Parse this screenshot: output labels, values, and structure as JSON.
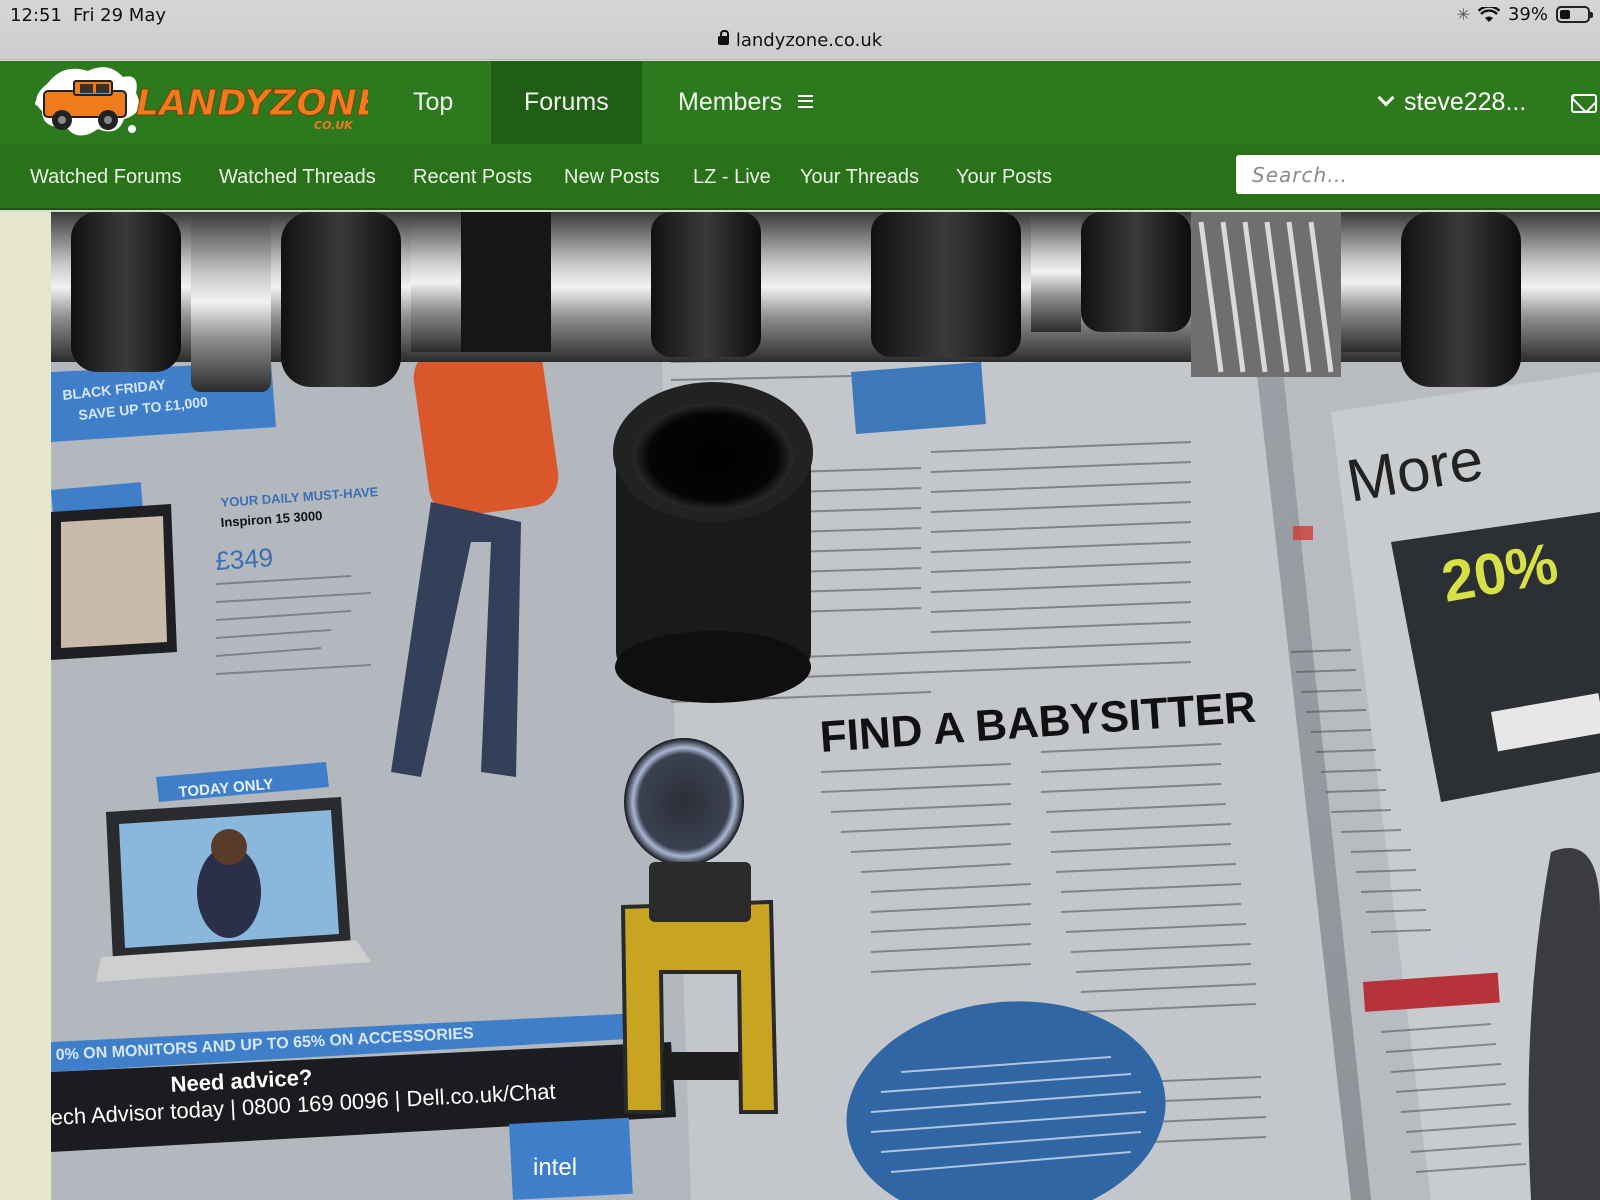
{
  "status": {
    "time": "12:51",
    "date": "Fri 29 May",
    "battery": "39%",
    "battery_level": 0.39
  },
  "browser": {
    "url": "landyzone.co.uk"
  },
  "logo": {
    "name": "LANDYZONE",
    "suffix": "CO.UK"
  },
  "nav": {
    "tabs": [
      {
        "label": "Top"
      },
      {
        "label": "Forums"
      },
      {
        "label": "Members"
      }
    ],
    "user": "steve228..."
  },
  "subnav": {
    "items": [
      {
        "label": "Watched Forums"
      },
      {
        "label": "Watched Threads"
      },
      {
        "label": "Recent Posts"
      },
      {
        "label": "New Posts"
      },
      {
        "label": "LZ - Live"
      },
      {
        "label": "Your Threads"
      },
      {
        "label": "Your Posts"
      }
    ],
    "search_placeholder": "Search…"
  },
  "photo": {
    "newspaper_headline": "FIND A BABYSITTER",
    "ad_text_1": "YOUR DAILY MUST-HAVE",
    "ad_text_2": "Inspiron 15 3000",
    "ad_price": "£349",
    "ad_today": "TODAY ONLY",
    "ad_help": "Need advice?",
    "ad_phone": "ech Advisor today | 0800 169 0096 | Dell.co.uk/Chat",
    "ad_promo": "0% ON MONITORS AND UP TO 65% ON ACCESSORIES",
    "ad_black_friday": "BLACK FRIDAY",
    "ad_save": "SAVE UP TO £1,000",
    "right_page": "More",
    "right_offer": "20%",
    "intel": "intel"
  },
  "colors": {
    "nav_green": "#2d7a1e",
    "nav_active": "#1f5e14",
    "logo_orange": "#f07b1d"
  }
}
